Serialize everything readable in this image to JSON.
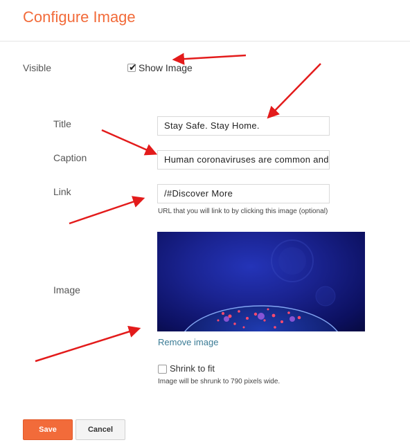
{
  "dialog": {
    "title": "Configure Image"
  },
  "visible": {
    "label": "Visible",
    "checkbox_label": "Show Image",
    "checked": true
  },
  "fields": {
    "title": {
      "label": "Title",
      "value": "Stay Safe. Stay Home."
    },
    "caption": {
      "label": "Caption",
      "value": "Human coronaviruses are common and a"
    },
    "link": {
      "label": "Link",
      "value": "/#Discover More",
      "hint": "URL that you will link to by clicking this image (optional)"
    }
  },
  "image": {
    "label": "Image",
    "remove_label": "Remove image",
    "shrink_label": "Shrink to fit",
    "shrink_checked": false,
    "shrink_hint": "Image will be shrunk to 790 pixels wide."
  },
  "buttons": {
    "save": "Save",
    "cancel": "Cancel"
  },
  "colors": {
    "accent": "#f26b3a",
    "link": "#3a7b95",
    "annotation_arrow": "#e31b1b"
  }
}
